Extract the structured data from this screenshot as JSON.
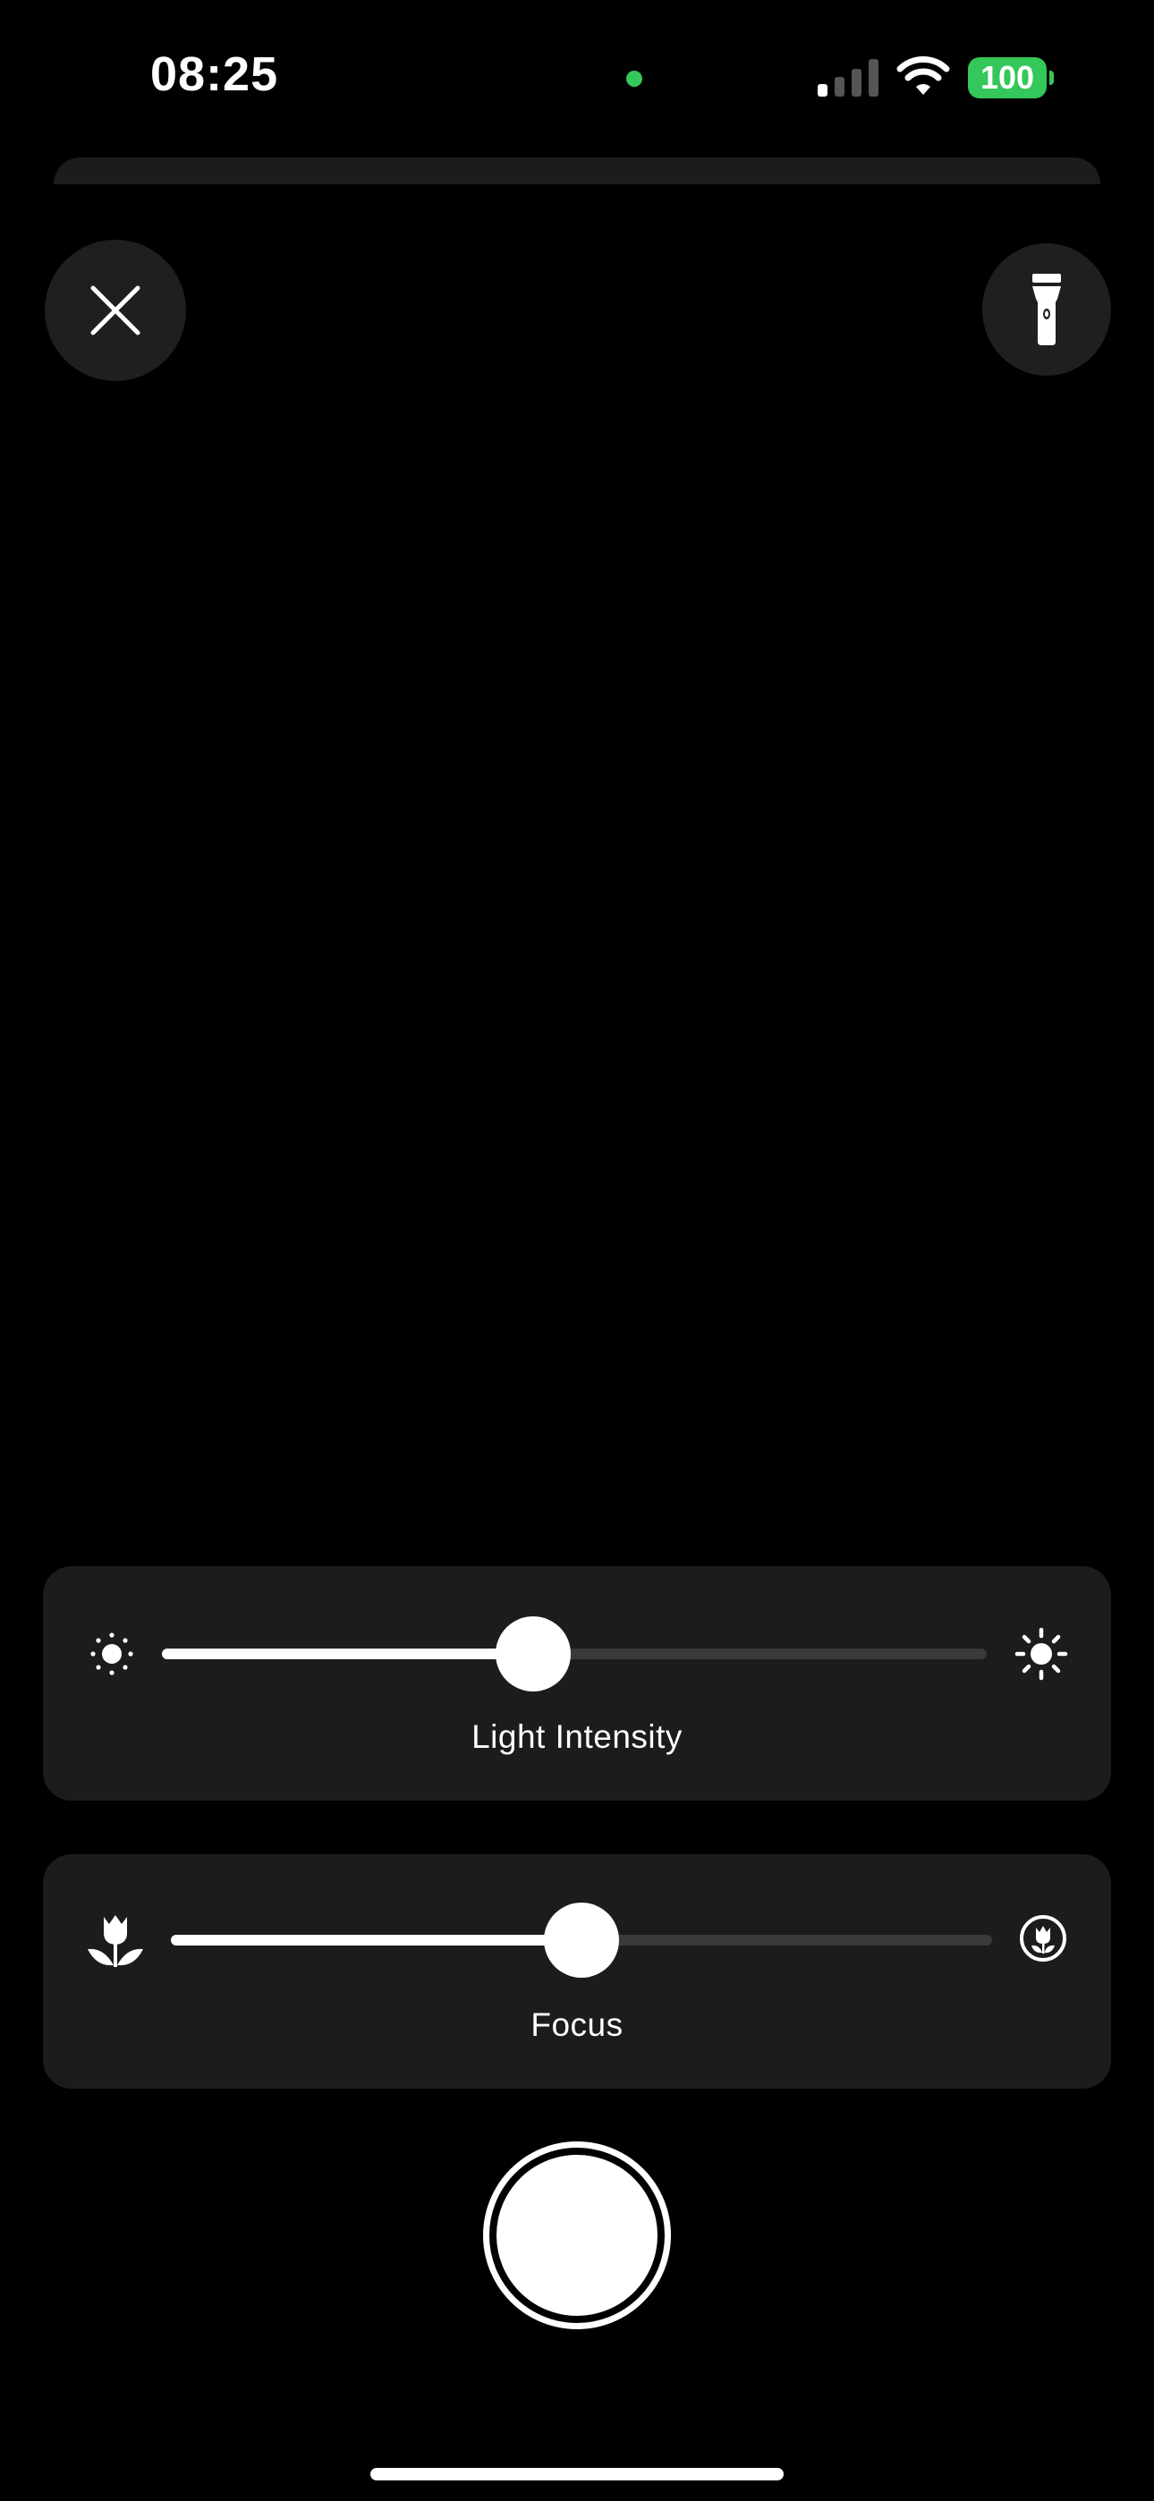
{
  "status_bar": {
    "time": "08:25",
    "battery_level": "100",
    "signal_bars_active": 1,
    "signal_bars_total": 4,
    "privacy_indicator_color": "#34c759",
    "battery_color": "#34c759"
  },
  "top_controls": {
    "close_icon": "close-icon",
    "flashlight_icon": "flashlight-icon"
  },
  "light_intensity": {
    "label": "Light Intensity",
    "value_fraction": 0.45,
    "min_icon": "sun-min-icon",
    "max_icon": "sun-max-icon"
  },
  "focus": {
    "label": "Focus",
    "value_fraction": 0.5,
    "min_icon": "flower-icon",
    "max_icon": "macro-flower-icon"
  },
  "shutter": {
    "icon": "shutter-button"
  },
  "colors": {
    "background": "#000000",
    "panel": "#1c1c1e",
    "track": "#3a3a3c",
    "accent": "#ffffff"
  }
}
